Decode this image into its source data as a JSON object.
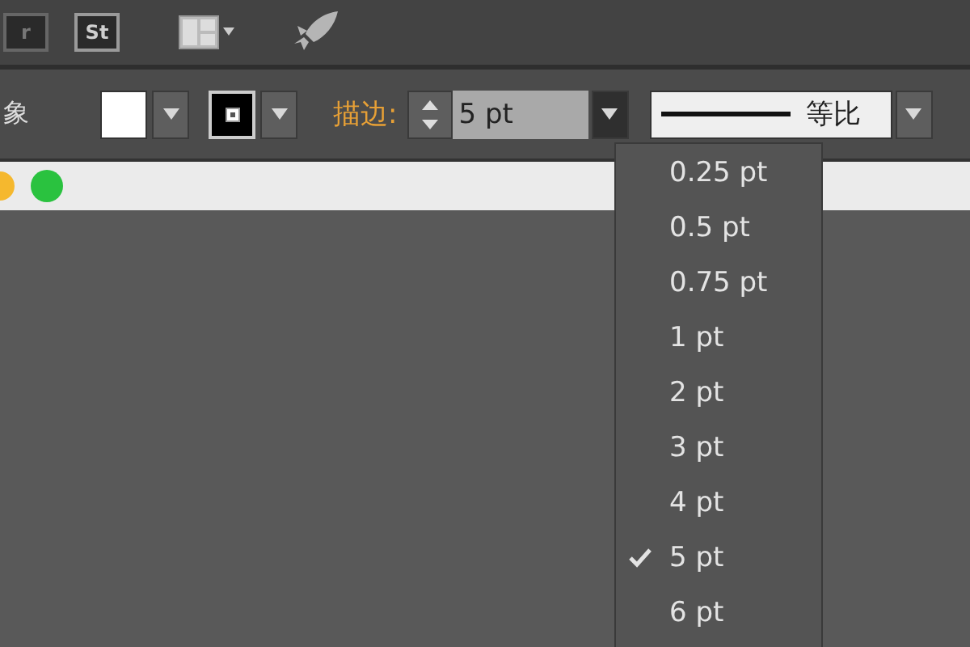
{
  "app_bar": {
    "bridge_label": "r",
    "stock_label": "St"
  },
  "control_bar": {
    "cut_label": "象",
    "stroke_label": "描边:",
    "stroke_weight": {
      "value": "5 pt"
    },
    "profile": {
      "label": "等比"
    }
  },
  "weight_menu": [
    {
      "label": "0.25 pt",
      "selected": false
    },
    {
      "label": "0.5 pt",
      "selected": false
    },
    {
      "label": "0.75 pt",
      "selected": false
    },
    {
      "label": "1 pt",
      "selected": false
    },
    {
      "label": "2 pt",
      "selected": false
    },
    {
      "label": "3 pt",
      "selected": false
    },
    {
      "label": "4 pt",
      "selected": false
    },
    {
      "label": "5 pt",
      "selected": true
    },
    {
      "label": "6 pt",
      "selected": false
    }
  ]
}
